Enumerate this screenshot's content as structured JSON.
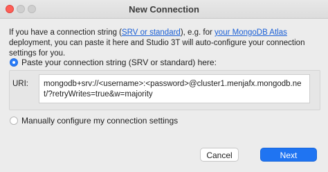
{
  "window": {
    "title": "New Connection"
  },
  "intro": {
    "p1": "If you have a connection string (",
    "link1": "SRV or standard",
    "p2": "), e.g. for ",
    "link2": "your MongoDB Atlas",
    "p3": " deployment, you can paste it here and Studio 3T will auto-configure your connection settings for you."
  },
  "options": {
    "paste_label": "Paste your connection string (SRV or standard) here:",
    "manual_label": "Manually configure my connection settings"
  },
  "uri": {
    "label": "URI:",
    "value": "mongodb+srv://<username>:<password>@cluster1.menjafx.mongodb.net/?retryWrites=true&w=majority"
  },
  "buttons": {
    "cancel": "Cancel",
    "next": "Next"
  }
}
